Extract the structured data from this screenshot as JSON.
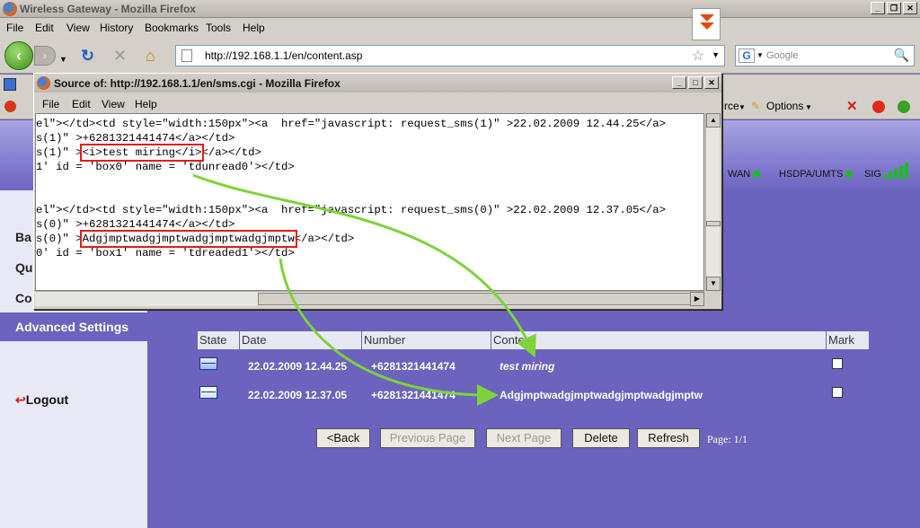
{
  "browser": {
    "title": "Wireless Gateway - Mozilla Firefox",
    "menu": [
      "File",
      "Edit",
      "View",
      "History",
      "Bookmarks",
      "Tools",
      "Help"
    ],
    "url": "http://192.168.1.1/en/content.asp",
    "search_placeholder": "Google",
    "search_engine_letter": "G",
    "toolbar_right_fragment": "rce",
    "options_label": "Options"
  },
  "source_window": {
    "title": "Source of: http://192.168.1.1/en/sms.cgi - Mozilla Firefox",
    "menu": [
      "File",
      "Edit",
      "View",
      "Help"
    ],
    "lines": {
      "l1a": "el\"></td><td style=\"width:150px\"><a  href=\"javascript: request_sms(1)\" >22.02.2009 12.44.25</a>",
      "l2": "s(1)\" >+6281321441474</a></td>",
      "l3_prefix": "s(1)\" >",
      "l3_boxed": "<i>test miring</i>",
      "l3_suffix": "</a></td>",
      "l4": "1' id = 'box0' name = 'tdunread0'></td>",
      "l5a": "el\"></td><td style=\"width:150px\"><a  href=\"javascript: request_sms(0)\" >22.02.2009 12.37.05</a>",
      "l6": "s(0)\" >+6281321441474</a></td>",
      "l7_prefix": "s(0)\" >",
      "l7_boxed": "Adgjmptwadgjmptwadgjmptwadgjmptw",
      "l7_suffix": "</a></td>",
      "l8": "0' id = 'box1' name = 'tdreaded1'></td>"
    }
  },
  "status": {
    "wan": "WAN",
    "hsdpa": "HSDPA/UMTS",
    "sig": "SIG",
    "led_color": "#1bbf1b"
  },
  "sidebar": {
    "partial_items": [
      "Ba",
      "Qu",
      "Co"
    ],
    "advanced": "Advanced Settings",
    "logout": "Logout"
  },
  "table": {
    "headers": [
      "State",
      "Date",
      "Number",
      "Content",
      "Mark"
    ],
    "rows": [
      {
        "date": "22.02.2009 12.44.25",
        "number": "+6281321441474",
        "content": "test miring",
        "italic": true
      },
      {
        "date": "22.02.2009 12.37.05",
        "number": "+6281321441474",
        "content": "Adgjmptwadgjmptwadgjmptwadgjmptw",
        "italic": false
      }
    ]
  },
  "buttons": {
    "back": "<Back",
    "prev": "Previous Page",
    "next": "Next Page",
    "delete": "Delete",
    "refresh": "Refresh",
    "page_info": "Page: 1/1"
  },
  "colors": {
    "page_bg": "#6b63be",
    "arrow": "#7ed23a",
    "highlight_box": "#e21c1c"
  }
}
